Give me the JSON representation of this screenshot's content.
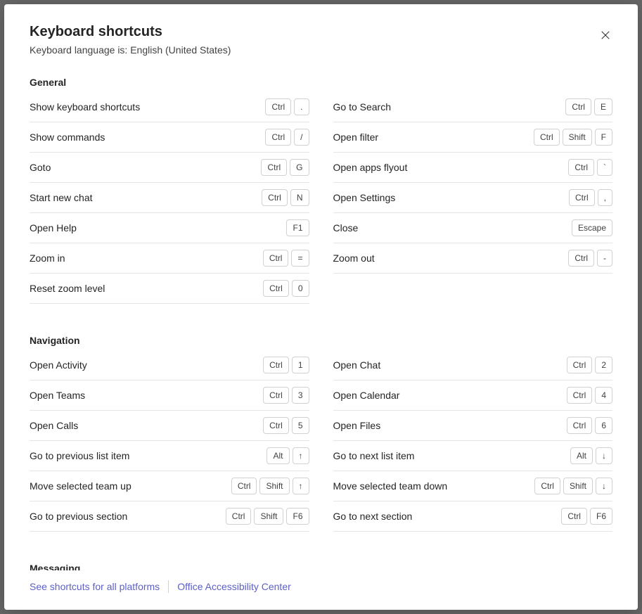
{
  "header": {
    "title": "Keyboard shortcuts",
    "subtitle": "Keyboard language is: English (United States)"
  },
  "footer": {
    "link_all_platforms": "See shortcuts for all platforms",
    "link_accessibility": "Office Accessibility Center"
  },
  "sections": [
    {
      "title": "General",
      "left": [
        {
          "label": "Show keyboard shortcuts",
          "keys": [
            "Ctrl",
            "."
          ]
        },
        {
          "label": "Show commands",
          "keys": [
            "Ctrl",
            "/"
          ]
        },
        {
          "label": "Goto",
          "keys": [
            "Ctrl",
            "G"
          ]
        },
        {
          "label": "Start new chat",
          "keys": [
            "Ctrl",
            "N"
          ]
        },
        {
          "label": "Open Help",
          "keys": [
            "F1"
          ]
        },
        {
          "label": "Zoom in",
          "keys": [
            "Ctrl",
            "="
          ]
        },
        {
          "label": "Reset zoom level",
          "keys": [
            "Ctrl",
            "0"
          ]
        }
      ],
      "right": [
        {
          "label": "Go to Search",
          "keys": [
            "Ctrl",
            "E"
          ]
        },
        {
          "label": "Open filter",
          "keys": [
            "Ctrl",
            "Shift",
            "F"
          ]
        },
        {
          "label": "Open apps flyout",
          "keys": [
            "Ctrl",
            "`"
          ]
        },
        {
          "label": "Open Settings",
          "keys": [
            "Ctrl",
            ","
          ]
        },
        {
          "label": "Close",
          "keys": [
            "Escape"
          ]
        },
        {
          "label": "Zoom out",
          "keys": [
            "Ctrl",
            "-"
          ]
        }
      ]
    },
    {
      "title": "Navigation",
      "left": [
        {
          "label": "Open Activity",
          "keys": [
            "Ctrl",
            "1"
          ]
        },
        {
          "label": "Open Teams",
          "keys": [
            "Ctrl",
            "3"
          ]
        },
        {
          "label": "Open Calls",
          "keys": [
            "Ctrl",
            "5"
          ]
        },
        {
          "label": "Go to previous list item",
          "keys": [
            "Alt",
            "↑"
          ]
        },
        {
          "label": "Move selected team up",
          "keys": [
            "Ctrl",
            "Shift",
            "↑"
          ]
        },
        {
          "label": "Go to previous section",
          "keys": [
            "Ctrl",
            "Shift",
            "F6"
          ]
        }
      ],
      "right": [
        {
          "label": "Open Chat",
          "keys": [
            "Ctrl",
            "2"
          ]
        },
        {
          "label": "Open Calendar",
          "keys": [
            "Ctrl",
            "4"
          ]
        },
        {
          "label": "Open Files",
          "keys": [
            "Ctrl",
            "6"
          ]
        },
        {
          "label": "Go to next list item",
          "keys": [
            "Alt",
            "↓"
          ]
        },
        {
          "label": "Move selected team down",
          "keys": [
            "Ctrl",
            "Shift",
            "↓"
          ]
        },
        {
          "label": "Go to next section",
          "keys": [
            "Ctrl",
            "F6"
          ]
        }
      ]
    },
    {
      "title": "Messaging",
      "left": [],
      "right": []
    }
  ]
}
